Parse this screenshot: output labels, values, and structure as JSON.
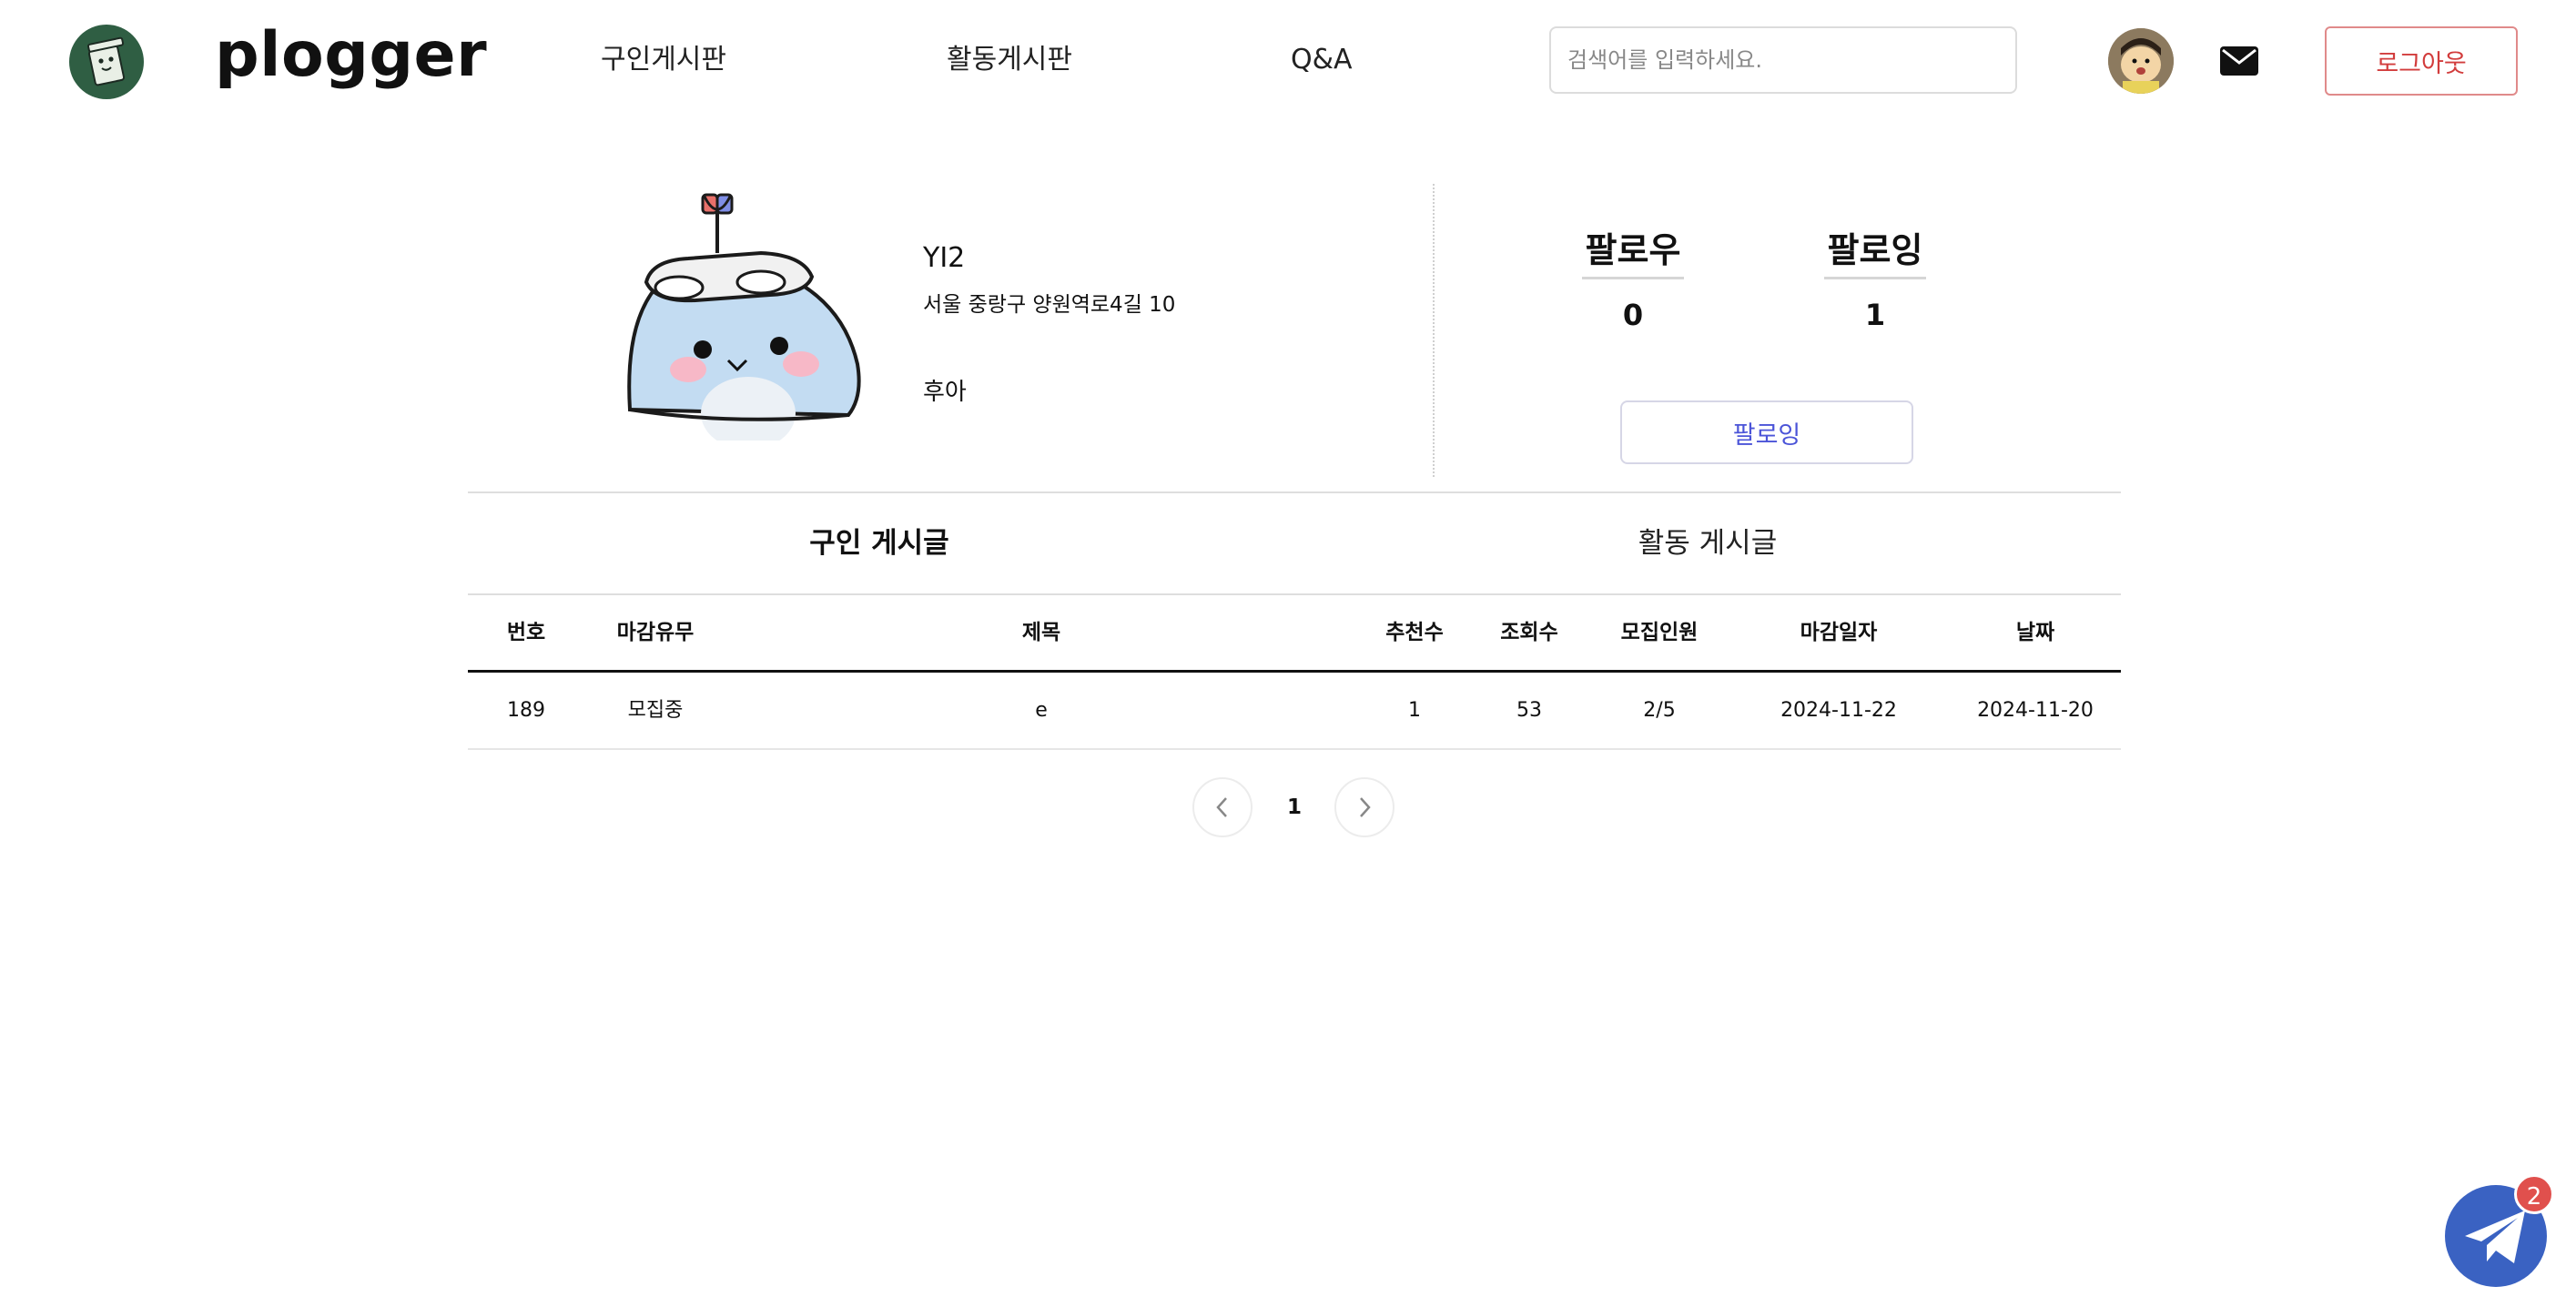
{
  "header": {
    "brand": "plogger",
    "nav": [
      "구인게시판",
      "활동게시판",
      "Q&A"
    ],
    "search_placeholder": "검색어를 입력하세요.",
    "logout_label": "로그아웃"
  },
  "profile": {
    "username": "YI2",
    "address": "서울 중랑구 양원역로4길 10",
    "bio": "후아",
    "followers_label": "팔로우",
    "followers_count": "0",
    "following_label": "팔로잉",
    "following_count": "1",
    "follow_button_label": "팔로잉"
  },
  "tabs": [
    {
      "label": "구인 게시글",
      "active": true
    },
    {
      "label": "활동 게시글",
      "active": false
    }
  ],
  "table": {
    "columns": [
      "번호",
      "마감유무",
      "제목",
      "추천수",
      "조회수",
      "모집인원",
      "마감일자",
      "날짜"
    ],
    "rows": [
      [
        "189",
        "모집중",
        "e",
        "1",
        "53",
        "2/5",
        "2024-11-22",
        "2024-11-20"
      ]
    ]
  },
  "pagination": {
    "current_page": "1"
  },
  "chat": {
    "badge_count": "2"
  },
  "colors": {
    "logout": "#d23c3c",
    "follow_button": "#4b54d8",
    "logo_bg": "#2f5e43",
    "chat_fab": "#3a62c2",
    "badge": "#e0504d"
  }
}
